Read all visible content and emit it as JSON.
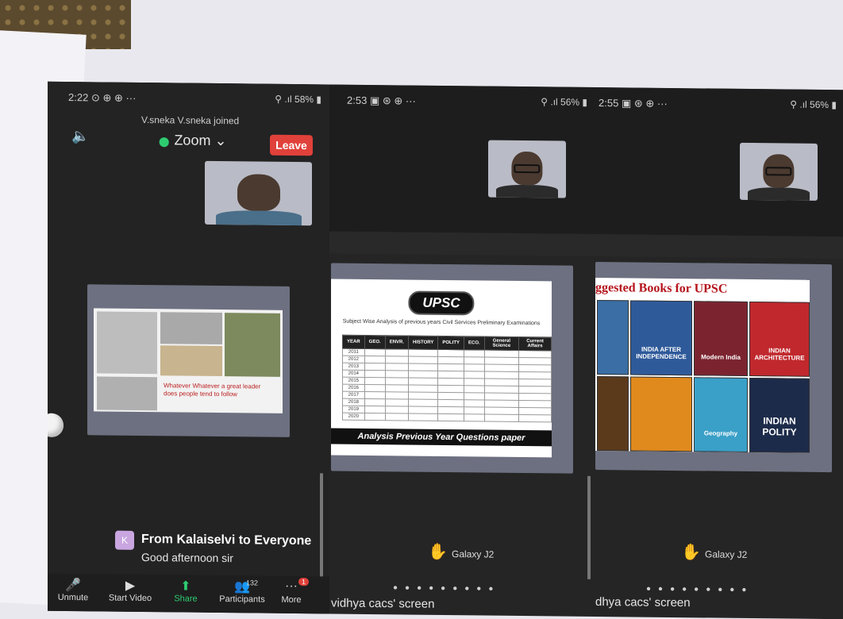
{
  "phone1": {
    "status_time": "2:22",
    "status_icons": "⊙ ⊕ ⊕ ···",
    "battery": "58%",
    "join_notice": "V.sneka V.sneka joined",
    "meeting_title": "Zoom",
    "leave_label": "Leave",
    "slide_quote": "Whatever Whatever a great leader does people tend to follow",
    "chat": {
      "avatar_letter": "K",
      "from": "From Kalaiselvi to Everyone",
      "message": "Good afternoon sir"
    },
    "toolbar": [
      {
        "icon": "mic-muted-icon",
        "glyph": "🎤",
        "label": "Unmute"
      },
      {
        "icon": "video-off-icon",
        "glyph": "▶",
        "label": "Start Video"
      },
      {
        "icon": "share-icon",
        "glyph": "⬆",
        "label": "Share"
      },
      {
        "icon": "participants-icon",
        "glyph": "👥",
        "label": "Participants",
        "count": "132"
      },
      {
        "icon": "more-icon",
        "glyph": "···",
        "label": "More",
        "badge": "1"
      }
    ]
  },
  "phone2": {
    "status_time": "2:53",
    "status_icons": "▣ ⊛ ⊕ ···",
    "battery": "56%",
    "slide": {
      "badge": "UPSC",
      "subtitle": "Subject Wise Analysis of previous years Civil Services Preliminary Examinations",
      "headers": [
        "YEAR",
        "GEO.",
        "ENVR.",
        "HISTORY",
        "POLITY",
        "ECO.",
        "General Science",
        "Current Affairs"
      ],
      "years": [
        "2011",
        "2012",
        "2013",
        "2014",
        "2015",
        "2016",
        "2017",
        "2018",
        "2019",
        "2020"
      ],
      "banner": "Analysis Previous Year Questions paper"
    },
    "device": "Galaxy J2",
    "screen_label": "vidhya cacs' screen"
  },
  "phone3": {
    "status_time": "2:55",
    "status_icons": "▣ ⊛ ⊕ ···",
    "battery": "56%",
    "slide": {
      "title": "ggested Books for UPSC",
      "books": [
        "",
        "INDIA AFTER INDEPENDENCE",
        "Modern India",
        "INDIAN ARCHITECTURE",
        "",
        "",
        "Geography",
        "INDIAN POLITY"
      ]
    },
    "device": "Galaxy J2",
    "screen_label": "dhya cacs' screen"
  },
  "colors": {
    "leave_red": "#e0413a",
    "share_green": "#2ecc71",
    "app_dark": "#232323",
    "book_title_red": "#b5151c"
  }
}
